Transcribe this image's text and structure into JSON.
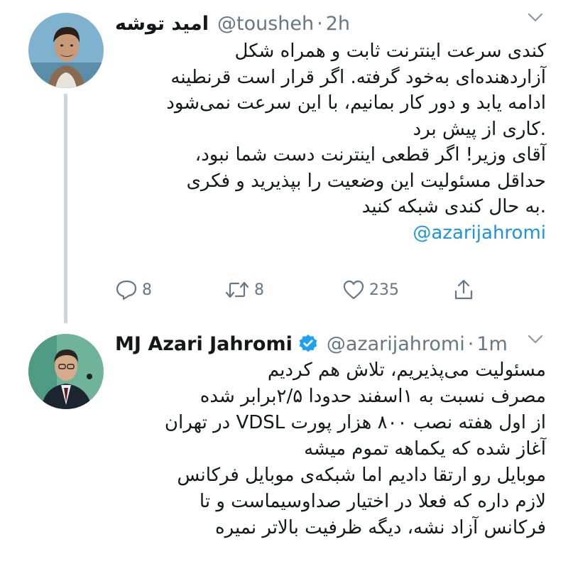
{
  "colors": {
    "text": "#14171a",
    "secondary": "#657786",
    "link": "#1b95e0",
    "thread_line": "#ccd6dd",
    "verified": "#1da1f2"
  },
  "tweets": [
    {
      "display_name": "امید توشه",
      "handle": "@tousheh",
      "separator": "·",
      "time": "2h",
      "avatar_icon": "user-avatar-photo",
      "lines": [
        "کندی سرعت اینترنت ثابت و همراه شکل",
        "آزاردهنده‌ای به‌خود گرفته. اگر قرار است قرنطینه",
        "ادامه یابد و دور کار بمانیم، با این سرعت نمی‌شود",
        ".کاری از پیش برد",
        "آقای وزیر! اگر قطعی اینترنت دست شما نبود،",
        "حداقل مسئولیت این وضعیت را بپذیرید و فکری",
        ".به حال کندی شبکه کنید"
      ],
      "mention": "@azarijahromi",
      "actions": {
        "replies": "8",
        "retweets": "8",
        "likes": "235"
      }
    },
    {
      "display_name": "MJ Azari Jahromi",
      "verified": true,
      "handle": "@azarijahromi",
      "separator": "·",
      "time": "1m",
      "avatar_icon": "user-avatar-photo",
      "lines": [
        "مسئولیت می‌پذیریم، تلاش هم کردیم",
        "مصرف نسبت به ۱اسفند حدودا ۲/۵برابر شده",
        "از اول هفته نصب ۸۰۰ هزار پورت VDSL در تهران",
        "آغاز شده که یکماهه تموم میشه",
        "موبایل رو ارتقا دادیم اما شبکه‌ی موبایل فرکانس",
        "لازم داره که فعلا در اختیار صداوسیماست و تا",
        "فرکانس آزاد نشه، دیگه ظرفیت بالاتر نمیره"
      ]
    }
  ]
}
